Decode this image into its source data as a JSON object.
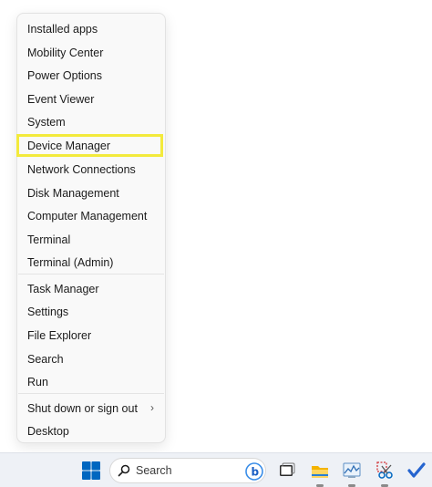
{
  "menu": {
    "items": [
      "Installed apps",
      "Mobility Center",
      "Power Options",
      "Event Viewer",
      "System",
      "Device Manager",
      "Network Connections",
      "Disk Management",
      "Computer Management",
      "Terminal",
      "Terminal (Admin)",
      "Task Manager",
      "Settings",
      "File Explorer",
      "Search",
      "Run",
      "Shut down or sign out",
      "Desktop"
    ],
    "submenu_chevron": "›",
    "highlighted_item": "Device Manager",
    "highlight_color": "#f3ea3c"
  },
  "taskbar": {
    "search_placeholder": "Search",
    "apps": [
      "start-icon",
      "search-icon",
      "bing-icon",
      "task-view-icon",
      "file-explorer-icon",
      "performance-monitor-icon",
      "snipping-tool-icon",
      "microsoft-todo-icon"
    ],
    "accent": "#0067c0"
  }
}
